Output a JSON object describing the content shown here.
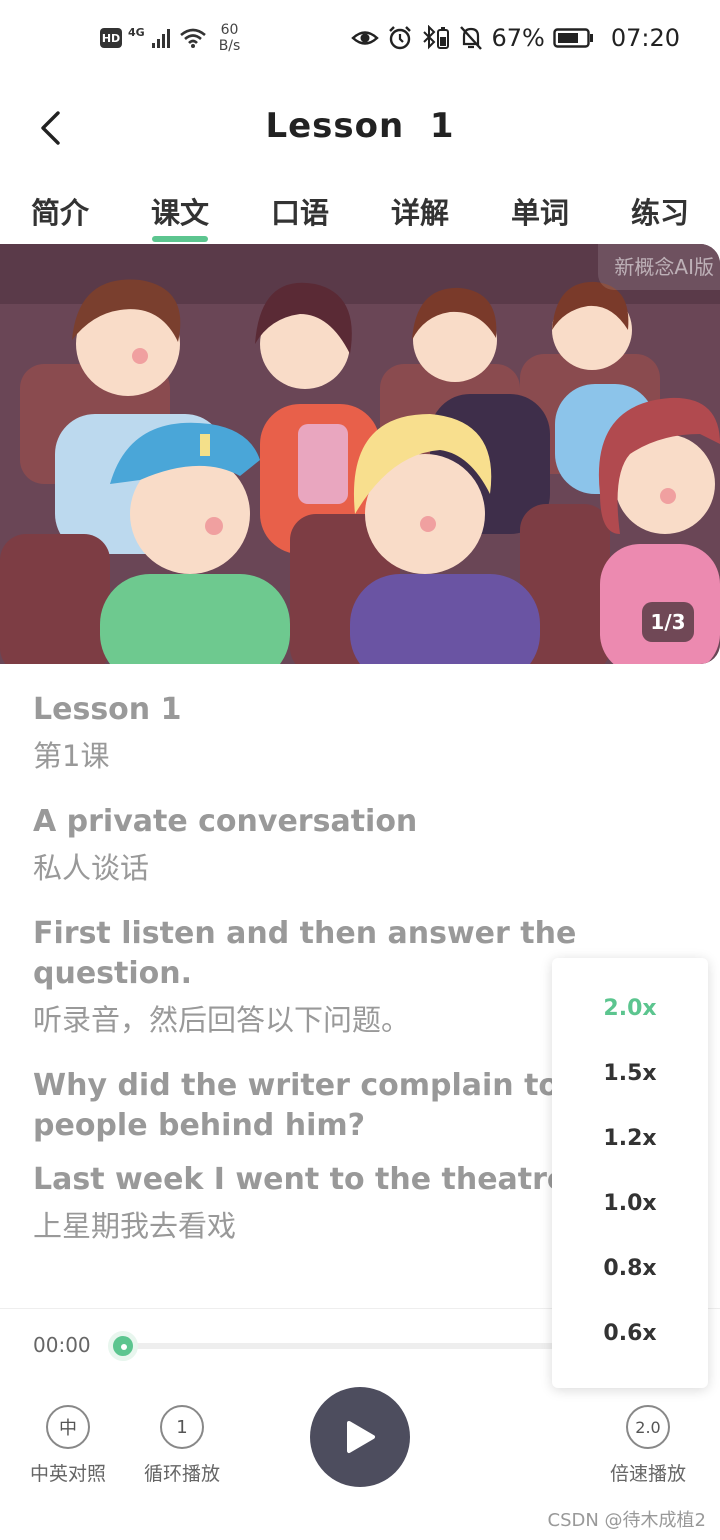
{
  "status_bar": {
    "hd": "HD",
    "network": "4G",
    "speed_value": "60",
    "speed_unit": "B/s",
    "battery": "67%",
    "time": "07:20"
  },
  "header": {
    "title": "Lesson  1"
  },
  "tabs": [
    {
      "label": "简介"
    },
    {
      "label": "课文",
      "active": true
    },
    {
      "label": "口语"
    },
    {
      "label": "详解"
    },
    {
      "label": "单词"
    },
    {
      "label": "练习"
    }
  ],
  "banner": {
    "tag": "新概念AI版",
    "counter": "1/3"
  },
  "lesson": [
    {
      "en": "Lesson 1",
      "zh": "第1课"
    },
    {
      "en": "A private conversation",
      "zh": "私人谈话"
    },
    {
      "en": "First listen and then answer the question.",
      "zh": "听录音，然后回答以下问题。"
    },
    {
      "en": "Why did the writer complain to the people behind him?",
      "zh": ""
    },
    {
      "en": "Last week I went to the theatre.",
      "zh": "上星期我去看戏"
    }
  ],
  "player": {
    "current_time": "00:00",
    "progress": 0,
    "bilingual_icon": "中",
    "bilingual_label": "中英对照",
    "loop_icon": "1",
    "loop_label": "循环播放",
    "speed_icon": "2.0",
    "speed_label": "倍速播放"
  },
  "speed_menu": {
    "options": [
      "2.0x",
      "1.5x",
      "1.2x",
      "1.0x",
      "0.8x",
      "0.6x"
    ],
    "selected": "2.0x"
  },
  "watermark": "CSDN @待木成植2",
  "colors": {
    "accent": "#5cc58f",
    "play_button": "#4d4d5e",
    "banner_bg": "#6d4a5a"
  }
}
